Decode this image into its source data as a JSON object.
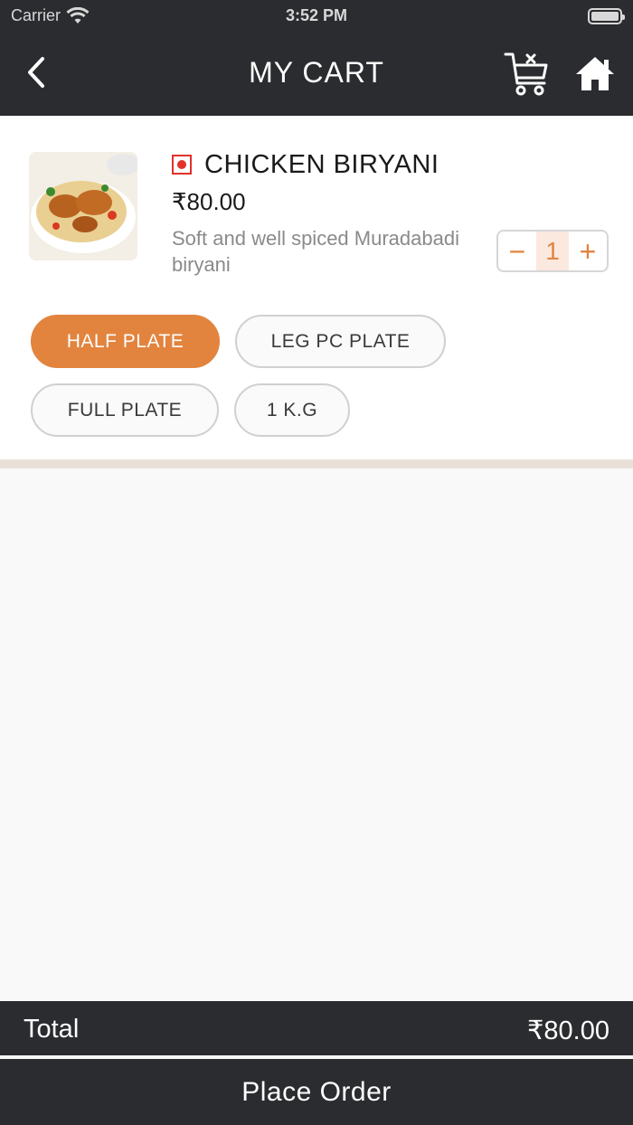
{
  "status_bar": {
    "carrier": "Carrier",
    "time": "3:52 PM"
  },
  "header": {
    "title": "MY CART",
    "back_icon": "chevron-left-icon",
    "clear_cart_icon": "cart-remove-icon",
    "home_icon": "home-icon"
  },
  "cart_item": {
    "name": "CHICKEN BIRYANI",
    "price": "₹80.00",
    "description": "Soft and well spiced Muradabadi biryani",
    "diet_marker_color": "#e0322b",
    "quantity": {
      "decrement": "−",
      "value": "1",
      "increment": "+"
    },
    "options": [
      {
        "label": "HALF PLATE",
        "selected": true
      },
      {
        "label": "LEG PC PLATE",
        "selected": false
      },
      {
        "label": "FULL PLATE",
        "selected": false
      },
      {
        "label": "1 K.G",
        "selected": false
      }
    ]
  },
  "footer": {
    "total_label": "Total",
    "total_amount": "₹80.00",
    "place_order_label": "Place Order"
  },
  "colors": {
    "header_bg": "#2a2c2f",
    "accent": "#e2843e",
    "background": "#f9f9f9"
  }
}
